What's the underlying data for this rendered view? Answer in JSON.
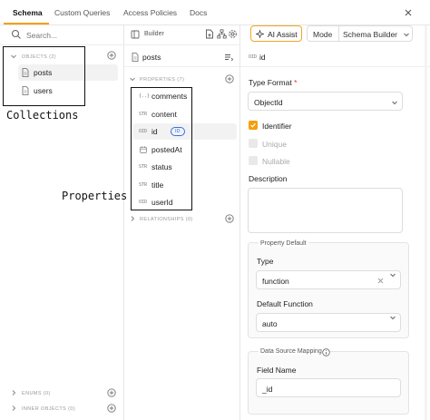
{
  "tabs": [
    {
      "label": "Schema"
    },
    {
      "label": "Custom Queries"
    },
    {
      "label": "Access Policies"
    },
    {
      "label": "Docs"
    }
  ],
  "left": {
    "search_placeholder": "Search...",
    "objects_label": "OBJECTS (2)",
    "objects": [
      {
        "label": "posts"
      },
      {
        "label": "users"
      }
    ],
    "enums_label": "ENUMS (0)",
    "inner_objects_label": "INNER OBJECTS (0)"
  },
  "annotations": {
    "collections": "Collections",
    "properties": "Properties"
  },
  "middle": {
    "builder_label": "Builder",
    "collection_title": "posts",
    "properties_label": "PROPERTIES (7)",
    "properties": [
      {
        "type": "{..}",
        "name": "comments"
      },
      {
        "type": "STR",
        "name": "content"
      },
      {
        "type": "OID",
        "name": "id",
        "badge": "ID"
      },
      {
        "type": "DATE",
        "name": "postedAt"
      },
      {
        "type": "STR",
        "name": "status"
      },
      {
        "type": "STR",
        "name": "title"
      },
      {
        "type": "OID",
        "name": "userId"
      }
    ],
    "relationships_label": "RELATIONSHIPS (0)"
  },
  "right": {
    "ai_assist_label": "AI Assist",
    "mode_label": "Mode",
    "mode_value": "Schema Builder",
    "field_type": "OID",
    "field_name": "id",
    "type_format_label": "Type Format",
    "required_mark": "*",
    "type_format_value": "ObjectId",
    "identifier_label": "Identifier",
    "unique_label": "Unique",
    "nullable_label": "Nullable",
    "description_label": "Description",
    "property_default_title": "Property Default",
    "default_type_label": "Type",
    "default_type_value": "function",
    "default_function_label": "Default Function",
    "default_function_value": "auto",
    "data_source_title": "Data Source Mapping",
    "field_name_label": "Field Name",
    "field_name_value": "_id"
  },
  "colors": {
    "accent": "#f59e0b",
    "id_badge": "#3b6fd8"
  }
}
